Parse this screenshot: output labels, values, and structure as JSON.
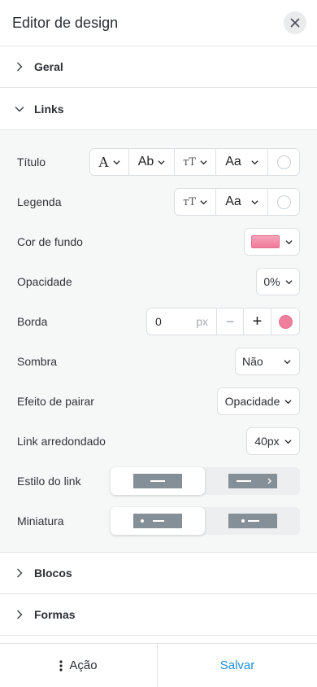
{
  "header": {
    "title": "Editor de design",
    "close_icon": "close-icon"
  },
  "sections": {
    "geral": "Geral",
    "links": "Links",
    "blocos": "Blocos",
    "formas": "Formas"
  },
  "links_panel": {
    "titulo": {
      "label": "Título",
      "font": "A",
      "style": "Ab",
      "size": "тT",
      "case": "Aa"
    },
    "legenda": {
      "label": "Legenda",
      "size": "тT",
      "case": "Aa"
    },
    "cor_de_fundo": {
      "label": "Cor de fundo",
      "color": "#f48aa6"
    },
    "opacidade": {
      "label": "Opacidade",
      "value": "0%"
    },
    "borda": {
      "label": "Borda",
      "value": "0",
      "unit": "px",
      "minus": "−",
      "plus": "+",
      "color": "#ef7f9d"
    },
    "sombra": {
      "label": "Sombra",
      "value": "Não"
    },
    "efeito": {
      "label": "Efeito de pairar",
      "value": "Opacidade"
    },
    "arredondado": {
      "label": "Link arredondado",
      "value": "40px"
    },
    "estilo": {
      "label": "Estilo do link",
      "selected": 0
    },
    "miniatura": {
      "label": "Miniatura",
      "selected": 0
    }
  },
  "footer": {
    "action": "Ação",
    "save": "Salvar"
  },
  "colors": {
    "accent": "#1c8fe0",
    "swatch_bg": "#f48aa6",
    "border_color": "#ef7f9d",
    "preview": "#858f97"
  }
}
